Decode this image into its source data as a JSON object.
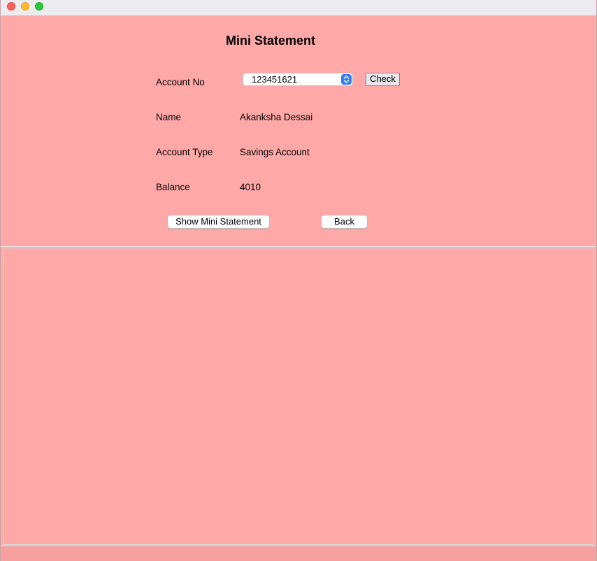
{
  "window": {
    "title_buttons": [
      "close",
      "minimize",
      "zoom"
    ]
  },
  "form": {
    "title": "Mini Statement",
    "account_no_label": "Account No",
    "account_no_value": "123451621",
    "check_label": "Check",
    "name_label": "Name",
    "name_value": "Akanksha Dessai",
    "account_type_label": "Account Type",
    "account_type_value": "Savings Account",
    "balance_label": "Balance",
    "balance_value": "4010",
    "show_statement_label": "Show Mini Statement",
    "back_label": "Back"
  },
  "colors": {
    "background": "#ffa8a8",
    "select_accent": "#2f7cf6"
  }
}
